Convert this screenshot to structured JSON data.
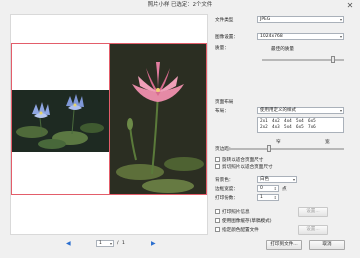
{
  "window": {
    "title": "照片小样  已选定：2个文件",
    "close_glyph": "✕"
  },
  "settings": {
    "file_type_label": "文件类型",
    "file_type_value": "JPEG",
    "image_size_label": "图像设置：",
    "image_size_value": "1024x768",
    "quality_label": "质量：",
    "quality_value_label": "最佳的质量",
    "quality_level": 0.88
  },
  "page_layout": {
    "section_label": "页面布局",
    "layout_label": "布局：",
    "layout_value": "使用用定义的样式",
    "layout_grid": [
      [
        "2x1",
        "4x2",
        "4x4",
        "5x4",
        "6x5"
      ],
      [
        "2x2",
        "4x3",
        "5x4",
        "6x5",
        "7x6"
      ]
    ],
    "spacing_label": "页边距：",
    "spacing_left": "窄",
    "spacing_right": "宽",
    "spacing_level": 0.36,
    "rotate_label": "旋转以适合页面尺寸",
    "crop_label": "剪切照片以适合页面尺寸",
    "bg_color_label": "背景色：",
    "bg_color_value": "白色",
    "border_width_label": "边框宽度：",
    "border_width_value": "0",
    "border_unit": "点",
    "copies_label": "打印份数：",
    "copies_value": "1",
    "print_info_label": "打印照片信息",
    "print_info_button": "设置...",
    "header_label": "使用图像缓存(草稿模式)",
    "color_profile_label": "指定颜色配置文件",
    "color_profile_button": "设置..."
  },
  "pagination": {
    "prev_glyph": "◀",
    "next_glyph": "▶",
    "current_page": "1",
    "separator": "/",
    "total_pages": "1"
  },
  "footer": {
    "print_button": "打印到文件...",
    "cancel_button": "取消"
  }
}
